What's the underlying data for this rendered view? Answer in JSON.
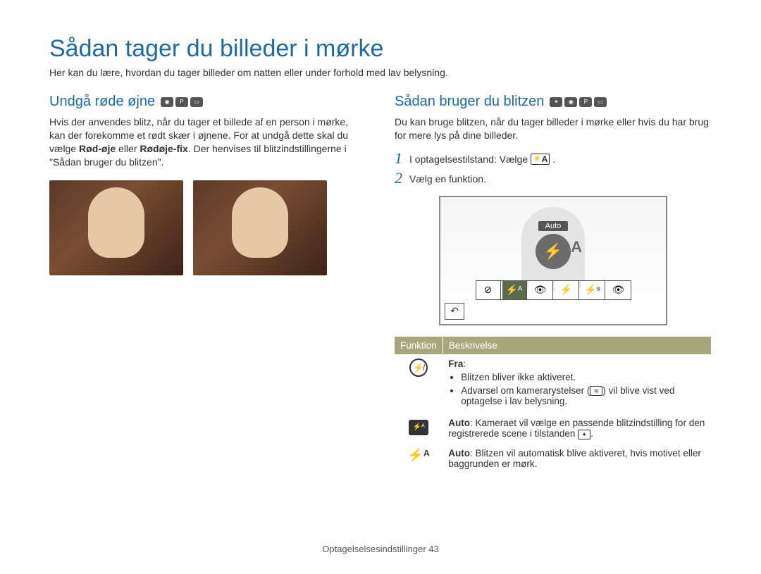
{
  "page_title": "Sådan tager du billeder i mørke",
  "intro": "Her kan du lære, hvordan du tager billeder om natten eller under forhold med lav belysning.",
  "left": {
    "heading": "Undgå røde øjne",
    "body_pre": "Hvis der anvendes blitz, når du tager et billede af en person i mørke, kan der forekomme et rødt skær i øjnene. For at undgå dette skal du vælge ",
    "bold1": "Rød-øje",
    "mid": " eller ",
    "bold2": "Rødøje-fix",
    "body_post": ". Der henvises til blitzindstillingerne i \"Sådan bruger du blitzen\"."
  },
  "right": {
    "heading": "Sådan bruger du blitzen",
    "body": "Du kan bruge blitzen, når du tager billeder i mørke eller hvis du har brug for mere lys på dine billeder.",
    "step1": "I optagelsestilstand: Vælge ",
    "step1_icon_label": "A",
    "step1_suffix": ".",
    "step2": "Vælg en funktion.",
    "lcd_label": "Auto",
    "table": {
      "header_func": "Funktion",
      "header_desc": "Beskrivelse",
      "rows": [
        {
          "icon": "off",
          "title": "Fra",
          "bullets": [
            "Blitzen bliver ikke aktiveret.",
            "Advarsel om kamerarystelser (shake) vil blive vist ved optagelse i lav belysning."
          ]
        },
        {
          "icon": "auto-scene",
          "desc_bold": "Auto",
          "desc": ": Kameraet vil vælge en passende blitzindstilling for den registrerede scene i tilstanden ",
          "desc_suffix": "."
        },
        {
          "icon": "auto-a",
          "desc_bold": "Auto",
          "desc": ": Blitzen vil automatisk blive aktiveret, hvis motivet eller baggrunden er mørk."
        }
      ]
    }
  },
  "footer_label": "Optagelselsesindstillinger",
  "footer_page": "43"
}
